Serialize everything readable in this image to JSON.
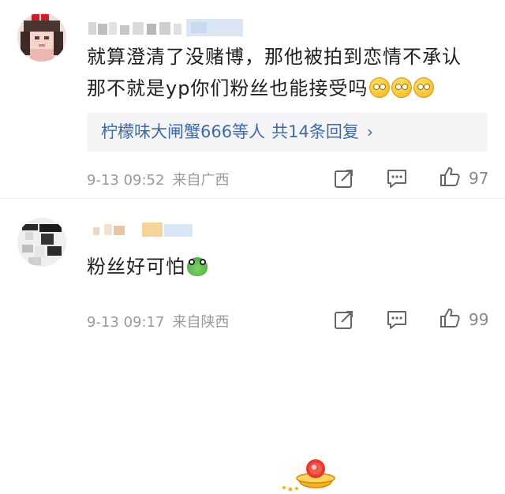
{
  "comments": [
    {
      "text_line1": "就算澄清了没赌博，那他被拍到恋情不承认",
      "text_line2": "那不就是yp你们粉丝也能接受吗",
      "emoji_line2": [
        "sweat-smile-emoji",
        "grimace-emoji",
        "grimace-emoji"
      ],
      "reply_summary": {
        "users": "柠檬味大闸蟹666等人",
        "count": "共14条回复",
        "chevron": "›"
      },
      "date": "9-13 09:52",
      "location": "来自广西",
      "likes": "97"
    },
    {
      "text": "粉丝好可怕",
      "emoji": "frog-emoji",
      "date": "9-13 09:17",
      "location": "来自陕西",
      "likes": "99"
    }
  ],
  "icons": {
    "share": "share-icon",
    "comment": "comment-icon",
    "like": "thumbs-up-icon"
  },
  "colors": {
    "reply_link": "#3e6ba6",
    "meta_gray": "#999999",
    "reply_box_bg": "#f5f5f7"
  }
}
